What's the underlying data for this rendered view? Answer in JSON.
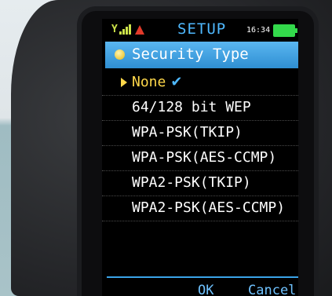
{
  "status": {
    "signal_label": "Y",
    "screen_title": "SETUP",
    "clock": "16:34"
  },
  "header": {
    "label": "Security Type"
  },
  "options": [
    {
      "label": "None",
      "selected": true
    },
    {
      "label": "64/128 bit WEP",
      "selected": false
    },
    {
      "label": "WPA-PSK(TKIP)",
      "selected": false
    },
    {
      "label": "WPA-PSK(AES-CCMP)",
      "selected": false
    },
    {
      "label": "WPA2-PSK(TKIP)",
      "selected": false
    },
    {
      "label": "WPA2-PSK(AES-CCMP)",
      "selected": false
    }
  ],
  "selected_mark": "✔",
  "softkeys": {
    "left": "OK",
    "right": "Cancel"
  },
  "colors": {
    "title_blue": "#4fb9ff",
    "header_blue": "#2f8fd3",
    "selection_yellow": "#ffd84a",
    "battery_green": "#33d94b",
    "warning_red": "#e23a2a"
  },
  "icons": {
    "signal": "signal-strength-icon",
    "warning": "warning-triangle-icon",
    "battery": "battery-icon",
    "header_bullet": "bullet-icon",
    "selection": "caret-right-icon",
    "check": "check-icon"
  }
}
